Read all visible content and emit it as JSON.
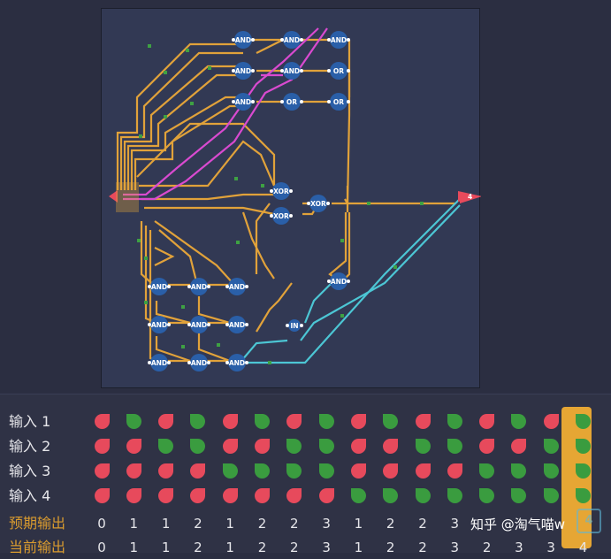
{
  "board": {
    "gates": [
      {
        "id": "and1",
        "label": "AND"
      },
      {
        "id": "and2",
        "label": "AND"
      },
      {
        "id": "and3",
        "label": "AND"
      },
      {
        "id": "and4",
        "label": "AND"
      },
      {
        "id": "and5",
        "label": "AND"
      },
      {
        "id": "or1",
        "label": "OR"
      },
      {
        "id": "and6",
        "label": "AND"
      },
      {
        "id": "or2",
        "label": "OR"
      },
      {
        "id": "or3",
        "label": "OR"
      },
      {
        "id": "xor1",
        "label": "XOR"
      },
      {
        "id": "xor2",
        "label": "XOR"
      },
      {
        "id": "xor3",
        "label": "XOR"
      },
      {
        "id": "and7",
        "label": "AND"
      },
      {
        "id": "and8",
        "label": "AND"
      },
      {
        "id": "and9",
        "label": "AND"
      },
      {
        "id": "and10",
        "label": "AND"
      },
      {
        "id": "and11",
        "label": "AND"
      },
      {
        "id": "and12",
        "label": "AND"
      },
      {
        "id": "and13",
        "label": "AND"
      },
      {
        "id": "and14",
        "label": "AND"
      },
      {
        "id": "and15",
        "label": "AND"
      },
      {
        "id": "and16",
        "label": "AND"
      },
      {
        "id": "in1",
        "label": "IN"
      }
    ],
    "output_label": "4",
    "colors": {
      "orange": "#e1a23a",
      "magenta": "#d94ad0",
      "cyan": "#4cc6d4",
      "gate": "#2a5fa8",
      "green_node": "#3ea143"
    }
  },
  "truth_table": {
    "rows": [
      {
        "label": "输入 1",
        "cells": [
          "red",
          "green",
          "red",
          "green",
          "red",
          "green",
          "red",
          "green",
          "red",
          "green",
          "red",
          "green",
          "red",
          "green",
          "red",
          "green"
        ]
      },
      {
        "label": "输入 2",
        "cells": [
          "red",
          "red",
          "green",
          "green",
          "red",
          "red",
          "green",
          "green",
          "red",
          "red",
          "green",
          "green",
          "red",
          "red",
          "green",
          "green"
        ]
      },
      {
        "label": "输入 3",
        "cells": [
          "red",
          "red",
          "red",
          "red",
          "green",
          "green",
          "green",
          "green",
          "red",
          "red",
          "red",
          "red",
          "green",
          "green",
          "green",
          "green"
        ]
      },
      {
        "label": "输入 4",
        "cells": [
          "red",
          "red",
          "red",
          "red",
          "red",
          "red",
          "red",
          "red",
          "green",
          "green",
          "green",
          "green",
          "green",
          "green",
          "green",
          "green"
        ]
      }
    ],
    "expected_label": "预期输出",
    "expected": [
      "0",
      "1",
      "1",
      "2",
      "1",
      "2",
      "2",
      "3",
      "1",
      "2",
      "2",
      "3",
      "",
      "",
      "",
      ""
    ],
    "current_label": "当前输出",
    "current": [
      "0",
      "1",
      "1",
      "2",
      "1",
      "2",
      "2",
      "3",
      "1",
      "2",
      "2",
      "3",
      "2",
      "3",
      "3",
      "4"
    ]
  },
  "watermark": {
    "text": "知乎 @淘气喵w",
    "logo": "4"
  }
}
